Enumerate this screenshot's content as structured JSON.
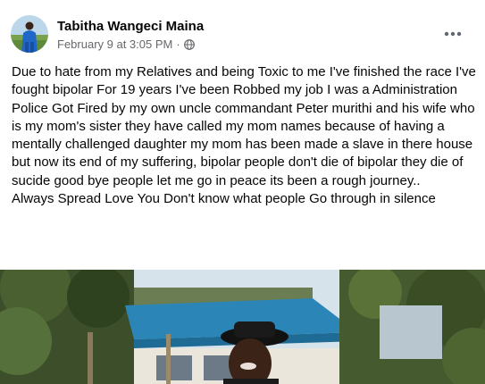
{
  "post": {
    "author": "Tabitha Wangeci Maina",
    "timestamp": "February 9 at 3:05 PM",
    "separator": "·",
    "audience_icon": "globe-icon",
    "more_icon": "more-options-icon",
    "body_paragraphs": [
      "Due to hate from my Relatives and being Toxic to me I've finished the race I've fought bipolar For 19 years I've been Robbed my job I was a Administration Police Got Fired by my own uncle commandant Peter murithi and his wife who is my mom's sister they have called my mom names because of having a mentally challenged daughter my mom has been made a slave in there house but now its end of my suffering, bipolar people don't die of bipolar they die of sucide good bye people let me go in peace its been a rough journey..",
      "Always Spread Love You Don't know what people Go through in silence"
    ]
  },
  "colors": {
    "text": "#050505",
    "secondary": "#65676b",
    "avatar_blue": "#1f66c9",
    "roof_blue": "#2b86b7"
  }
}
